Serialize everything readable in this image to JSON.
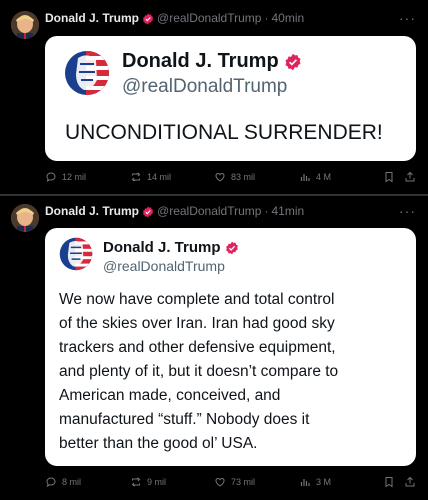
{
  "posts": [
    {
      "author": "Donald J. Trump",
      "handle": "@realDonaldTrump",
      "sep": "·",
      "time": "40min",
      "more": "···",
      "card": {
        "name": "Donald J. Trump",
        "handle": "@realDonaldTrump",
        "text": "UNCONDITIONAL SURRENDER!"
      },
      "stats": {
        "replies": "12 mil",
        "reposts": "14 mil",
        "likes": "83 mil",
        "views": "4 M"
      }
    },
    {
      "author": "Donald J. Trump",
      "handle": "@realDonaldTrump",
      "sep": "·",
      "time": "41min",
      "more": "···",
      "card": {
        "name": "Donald J. Trump",
        "handle": "@realDonaldTrump",
        "lines": [
          "We now have complete and total control",
          "of the skies over Iran. Iran had good sky",
          "trackers and other defensive equipment,",
          "and plenty of it, but it doesn’t compare to",
          "American made, conceived, and",
          "manufactured “stuff.” Nobody does it",
          "better than the good ol’ USA."
        ]
      },
      "stats": {
        "replies": "8 mil",
        "reposts": "9 mil",
        "likes": "73 mil",
        "views": "3 M"
      }
    }
  ],
  "colors": {
    "verified": "#e0245e",
    "background": "#000000",
    "card": "#ffffff",
    "muted": "#71767b"
  },
  "icons": [
    "verified-badge-icon",
    "reply-icon",
    "repost-icon",
    "like-icon",
    "views-icon",
    "bookmark-icon",
    "share-icon",
    "more-icon"
  ]
}
